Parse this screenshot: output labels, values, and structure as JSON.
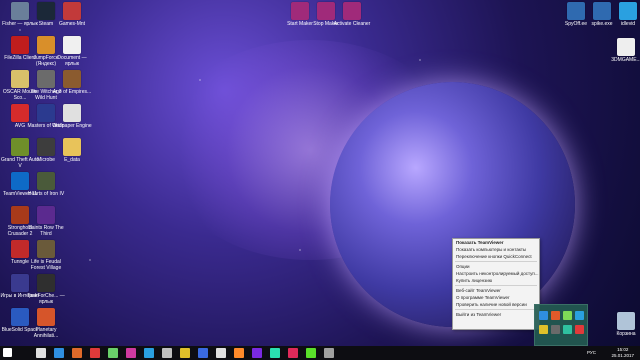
{
  "desktop": {
    "icons_left": [
      {
        "name": "icon-fisher",
        "label": "Fisher — ярлык",
        "color": "#6a7f9a",
        "col": 0,
        "row": 0
      },
      {
        "name": "icon-steam",
        "label": "Steam",
        "color": "#1b2838",
        "col": 1,
        "row": 0
      },
      {
        "name": "icon-games",
        "label": "Games-Mnt",
        "color": "#c23a3a",
        "col": 2,
        "row": 0
      },
      {
        "name": "icon-filezilla",
        "label": "FileZilla Client",
        "color": "#c01d1d",
        "col": 0,
        "row": 1
      },
      {
        "name": "icon-jump-force",
        "label": "JumpForce (Яндекс)",
        "color": "#d98f2a",
        "col": 1,
        "row": 1
      },
      {
        "name": "icon-text-file",
        "label": "Document — ярлык",
        "color": "#f0f0f0",
        "col": 2,
        "row": 1
      },
      {
        "name": "icon-oscar",
        "label": "OSCAR Mouse Sco...",
        "color": "#d8c06a",
        "col": 0,
        "row": 2
      },
      {
        "name": "icon-witcher",
        "label": "The Witcher 3 Wild Hunt",
        "color": "#6b6b6b",
        "col": 1,
        "row": 2
      },
      {
        "name": "icon-age",
        "label": "Age of Empires...",
        "color": "#8b5b2f",
        "col": 2,
        "row": 2
      },
      {
        "name": "icon-avg",
        "label": "AVG",
        "color": "#d62b2b",
        "col": 0,
        "row": 3
      },
      {
        "name": "icon-masters",
        "label": "Masters of Orion",
        "color": "#2b3a8f",
        "col": 1,
        "row": 3
      },
      {
        "name": "icon-wallpaper",
        "label": "Wallpaper Engine",
        "color": "#e0e0e0",
        "col": 2,
        "row": 3
      },
      {
        "name": "icon-gta",
        "label": "Grand Theft Auto V",
        "color": "#6f8f2a",
        "col": 0,
        "row": 4
      },
      {
        "name": "icon-microbe",
        "label": "Microbe",
        "color": "#3d3d3d",
        "col": 1,
        "row": 4
      },
      {
        "name": "icon-folder",
        "label": "E_data",
        "color": "#e8c35a",
        "col": 2,
        "row": 4
      },
      {
        "name": "icon-teamviewer",
        "label": "TeamViewer 11",
        "color": "#0e6ac7",
        "col": 0,
        "row": 5
      },
      {
        "name": "icon-hearts-iron",
        "label": "Hearts of Iron IV",
        "color": "#4a5a3a",
        "col": 1,
        "row": 5
      },
      {
        "name": "icon-stronghold",
        "label": "Stronghold Crusader 2",
        "color": "#a83a1a",
        "col": 0,
        "row": 6
      },
      {
        "name": "icon-saints-row",
        "label": "Saints Row The Third",
        "color": "#5b2a8f",
        "col": 1,
        "row": 6
      },
      {
        "name": "icon-tunngle",
        "label": "Tunngle",
        "color": "#c22a2a",
        "col": 0,
        "row": 7
      },
      {
        "name": "icon-life-feudal",
        "label": "Life is Feudal Forest Village",
        "color": "#6a5a3a",
        "col": 1,
        "row": 7
      },
      {
        "name": "icon-hearts2",
        "label": "Игры в Интернет",
        "color": "#3a3a8f",
        "col": 0,
        "row": 8
      },
      {
        "name": "icon-tasker",
        "label": "TaskForChe... — ярлык",
        "color": "#2f2f2f",
        "col": 1,
        "row": 8
      },
      {
        "name": "icon-bluestack",
        "label": "BlueSolid Space",
        "color": "#2a5ac0",
        "col": 0,
        "row": 9
      },
      {
        "name": "icon-planetary",
        "label": "Planetary Annihilati...",
        "color": "#d6552a",
        "col": 1,
        "row": 9
      }
    ],
    "icons_top_center": [
      {
        "name": "icon-startmaker-1",
        "label": "Start Maker",
        "color": "#a02a7a"
      },
      {
        "name": "icon-startmaker-2",
        "label": "Stop Maker",
        "color": "#a02a7a"
      },
      {
        "name": "icon-startmaker-3",
        "label": "Activate Cleaner",
        "color": "#a02a7a"
      }
    ],
    "icons_right": [
      {
        "name": "icon-spyoff",
        "label": "SpyOff.ee",
        "color": "#2f6ab0"
      },
      {
        "name": "icon-spike",
        "label": "spike.exe",
        "color": "#2f6ab0"
      },
      {
        "name": "icon-idlestar",
        "label": "idlevid",
        "color": "#2aa0e0"
      },
      {
        "name": "icon-document",
        "label": "3DMGAME...",
        "color": "#eeeeee"
      },
      {
        "name": "icon-recycle-bin",
        "label": "Корзина",
        "color": "#b0c4d8"
      }
    ]
  },
  "context_menu": {
    "items": [
      {
        "label": "Показать TeamViewer",
        "bold": true,
        "sep_after": false
      },
      {
        "label": "Показать компьютеры и контакты",
        "bold": false,
        "sep_after": false
      },
      {
        "label": "Переключение кнопки QuickConnect",
        "bold": false,
        "sep_after": true
      },
      {
        "label": "Опции",
        "bold": false,
        "sep_after": false
      },
      {
        "label": "Настроить неконтролируемый доступ...",
        "bold": false,
        "sep_after": false
      },
      {
        "label": "Купить лицензию",
        "bold": false,
        "sep_after": true
      },
      {
        "label": "Веб-сайт TeamViewer",
        "bold": false,
        "sep_after": false
      },
      {
        "label": "О программе TeamViewer",
        "bold": false,
        "sep_after": false
      },
      {
        "label": "Проверить наличие новой версии",
        "bold": false,
        "sep_after": true
      },
      {
        "label": "Выйти из TeamViewer",
        "bold": false,
        "sep_after": false
      }
    ]
  },
  "tray_popup": {
    "icons": [
      "#2f8fe0",
      "#e05a2a",
      "#7ed957",
      "#2aa0e0",
      "#e0c02a",
      "#6a6a6a",
      "#2fc0a0",
      "#e03a3a"
    ]
  },
  "taskbar": {
    "apps": [
      "#e0e0e0",
      "#2f8fe0",
      "#e06a2a",
      "#e03a3a",
      "#6ad06a",
      "#d03aa0",
      "#2aa0e0",
      "#c0c0c0",
      "#e0c02a",
      "#3a6ae0",
      "#e0e0e0",
      "#ff8a2a",
      "#7a2ae0",
      "#2ae0b0",
      "#e02a5a",
      "#5ae02a",
      "#a0a0a0"
    ],
    "lang": "РУС",
    "time": "15:02",
    "date": "25.01.2017"
  }
}
